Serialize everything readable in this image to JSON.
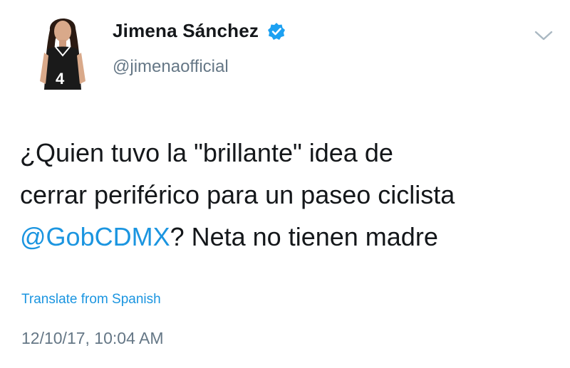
{
  "author": {
    "display_name": "Jimena Sánchez",
    "handle": "@jimenaofficial",
    "verified": true,
    "avatar_icon": "profile-photo"
  },
  "tweet": {
    "line1": "¿Quien tuvo la \"brillante\" idea de",
    "line2": "cerrar periférico para un paseo ciclista",
    "mention": "@GobCDMX",
    "line3_rest": "? Neta no tienen madre"
  },
  "actions": {
    "translate_label": "Translate from Spanish",
    "menu_icon": "chevron-down-icon"
  },
  "meta": {
    "timestamp": "12/10/17, 10:04 AM"
  },
  "colors": {
    "link": "#1b95e0",
    "secondary_text": "#657786",
    "primary_text": "#14171a",
    "verified_badge": "#1da1f2"
  }
}
